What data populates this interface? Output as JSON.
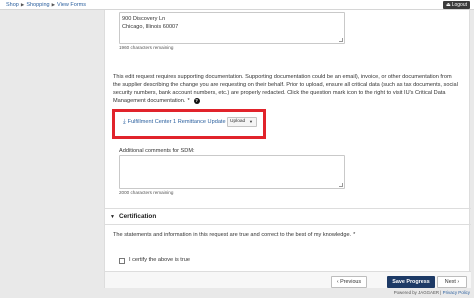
{
  "breadcrumb": {
    "items": [
      "Shop",
      "Shopping",
      "View Forms"
    ]
  },
  "header": {
    "logout_label": "Logout"
  },
  "address": {
    "line1": "900 Discovery Ln",
    "line2": "Chicago, Illinois 60007",
    "remaining": "1960 characters remaining"
  },
  "documentation": {
    "text": "This edit request requires supporting documentation. Supporting documentation could be an email), invoice, or other documentation from the supplier describing the change you are requesting on their behalf. Prior to upload, ensure all critical data (such as tax documents, social security numbers, bank account numbers, etc.) are properly redacted. Click the question mark icon to the right to visit IU's Critical Data Management documentation.",
    "required_mark": "*",
    "help_icon": "question-circle-icon"
  },
  "upload": {
    "file_link": "Fulfillment Center 1 Remittance Update",
    "button_label": "Upload",
    "download_icon": "download-icon"
  },
  "comments": {
    "label": "Additional comments for SDM:",
    "value": "",
    "remaining": "2000 characters remaining"
  },
  "certification": {
    "heading": "Certification",
    "statement": "The statements and information in this request are true and correct to the best of my knowledge.",
    "required_mark": "*",
    "checkbox_label": "I certify the above is true",
    "checked": false
  },
  "footer": {
    "previous_label": "Previous",
    "save_label": "Save Progress",
    "next_label": "Next"
  },
  "powered": {
    "prefix": "Powered by JAGGAER",
    "separator": " | ",
    "privacy": "Privacy Policy"
  },
  "colors": {
    "accent": "#1d3a66",
    "link": "#2a5f9e",
    "highlight": "#e1232b"
  }
}
